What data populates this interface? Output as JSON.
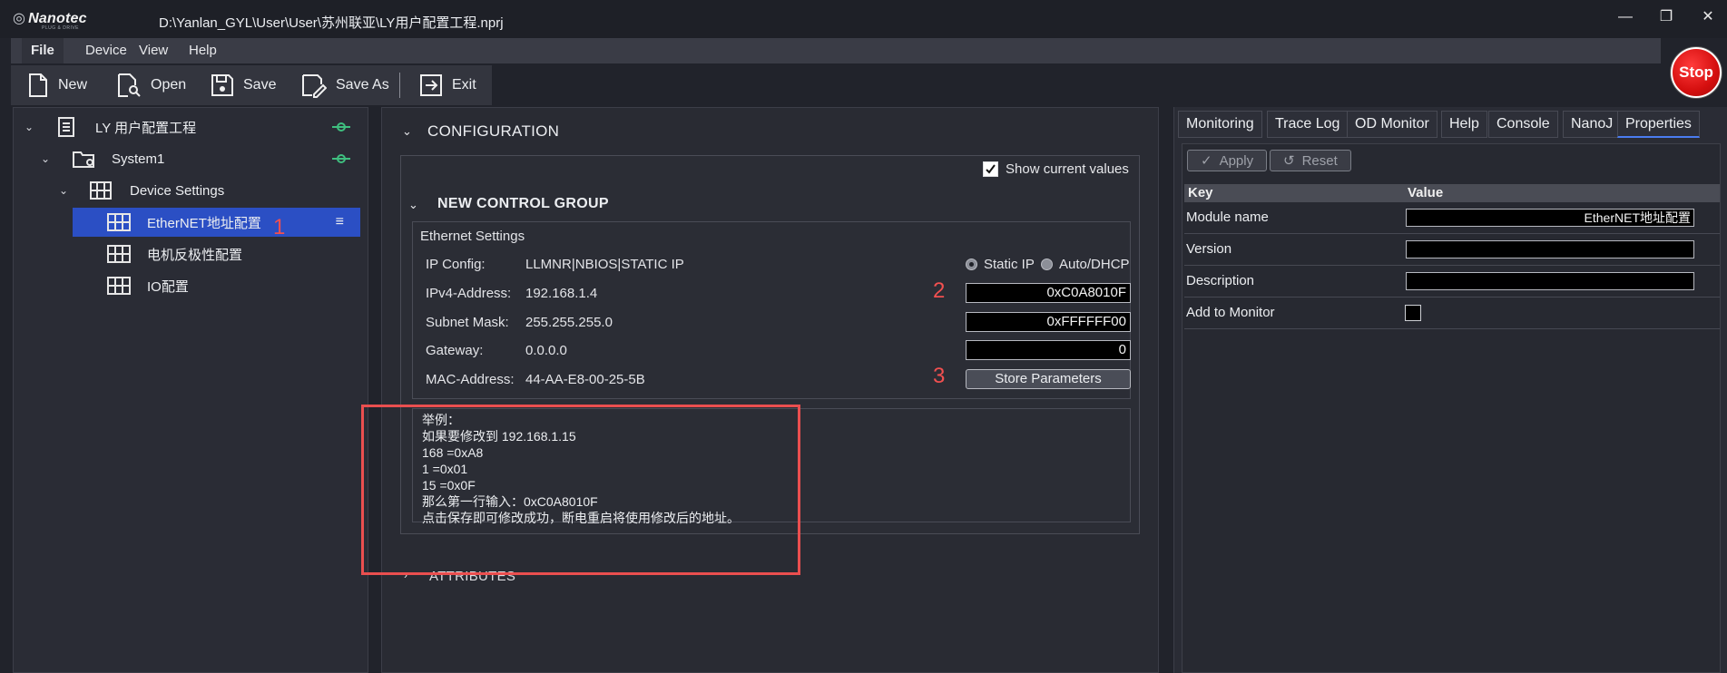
{
  "titlebar": {
    "brand": "Nanotec",
    "brand_sub": "PLUG & DRIVE",
    "path": "D:\\Yanlan_GYL\\User\\User\\苏州联亚\\LY用户配置工程.nprj"
  },
  "menu": [
    "File",
    "Device",
    "View",
    "Help"
  ],
  "toolbar": {
    "new": "New",
    "open": "Open",
    "save": "Save",
    "save_as": "Save As",
    "exit": "Exit"
  },
  "stop_label": "Stop",
  "tree": {
    "project": "LY 用户配置工程",
    "system": "System1",
    "device_settings": "Device Settings",
    "items": [
      "EtherNET地址配置",
      "电机反极性配置",
      "IO配置"
    ]
  },
  "annotations": [
    "1",
    "2",
    "3"
  ],
  "config": {
    "section_title": "CONFIGURATION",
    "show_current_values": "Show current values",
    "group_title": "NEW CONTROL GROUP",
    "eth_title": "Ethernet Settings",
    "rows": [
      {
        "label": "IP Config:",
        "value": "LLMNR|NBIOS|STATIC IP"
      },
      {
        "label": "IPv4-Address:",
        "value": "192.168.1.4",
        "field": "0xC0A8010F"
      },
      {
        "label": "Subnet Mask:",
        "value": "255.255.255.0",
        "field": "0xFFFFFF00"
      },
      {
        "label": "Gateway:",
        "value": "0.0.0.0",
        "field": "0"
      },
      {
        "label": "MAC-Address:",
        "value": "44-AA-E8-00-25-5B"
      }
    ],
    "radio_static": "Static IP",
    "radio_dhcp": "Auto/DHCP",
    "store_button": "Store Parameters",
    "notes": [
      "举例：",
      "如果要修改到 192.168.1.15",
      "168 =0xA8",
      "1 =0x01",
      "15 =0x0F",
      "那么第一行输入：0xC0A8010F",
      "点击保存即可修改成功，断电重启将使用修改后的地址。"
    ],
    "attributes_title": "ATTRIBUTES"
  },
  "right": {
    "tabs": [
      "Monitoring",
      "Trace Log",
      "OD Monitor",
      "Help",
      "Console",
      "NanoJ",
      "Properties"
    ],
    "apply": "Apply",
    "reset": "Reset",
    "col_key": "Key",
    "col_value": "Value",
    "rows": [
      {
        "key": "Module name",
        "value": "EtherNET地址配置"
      },
      {
        "key": "Version",
        "value": ""
      },
      {
        "key": "Description",
        "value": ""
      },
      {
        "key": "Add to Monitor",
        "value": ""
      }
    ]
  },
  "colors": {
    "selection": "#2b4fc4",
    "annotation_red": "#ea4f4f",
    "link_green": "#3fbf7f",
    "stop_red": "#d50f0f"
  }
}
